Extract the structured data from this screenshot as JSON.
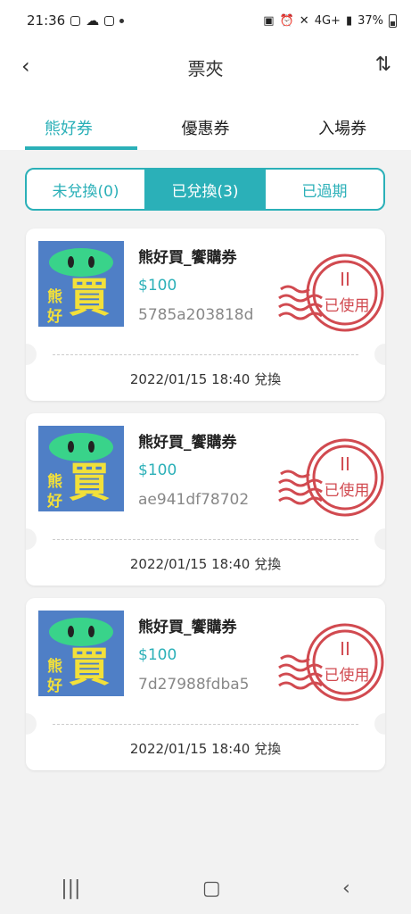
{
  "status_bar": {
    "time": "21:36",
    "battery": "37%",
    "network": "4G+"
  },
  "app_bar": {
    "title": "票夾",
    "back_icon": "‹",
    "sort_icon": "⇅"
  },
  "top_tabs": [
    {
      "label": "熊好券",
      "active": true
    },
    {
      "label": "優惠券",
      "active": false
    },
    {
      "label": "入場券",
      "active": false
    }
  ],
  "segments": [
    {
      "label": "未兌換(0)",
      "active": false
    },
    {
      "label": "已兌換(3)",
      "active": true
    },
    {
      "label": "已過期",
      "active": false
    }
  ],
  "coupons": [
    {
      "name": "熊好買_饗購券",
      "price": "$100",
      "code": "5785a203818d",
      "redeemed": "2022/01/15 18:40 兌換",
      "stamp": "已使用"
    },
    {
      "name": "熊好買_饗購券",
      "price": "$100",
      "code": "ae941df78702",
      "redeemed": "2022/01/15 18:40 兌換",
      "stamp": "已使用"
    },
    {
      "name": "熊好買_饗購券",
      "price": "$100",
      "code": "7d27988fdba5",
      "redeemed": "2022/01/15 18:40 兌換",
      "stamp": "已使用"
    }
  ],
  "thumb": {
    "small_top": "熊",
    "small_bottom": "好",
    "big": "買"
  },
  "colors": {
    "accent": "#2bb0b8",
    "stamp_red": "#d14a50",
    "thumb_blue": "#4f7fc6",
    "thumb_green": "#39d38a",
    "thumb_yellow": "#f2e03a"
  }
}
